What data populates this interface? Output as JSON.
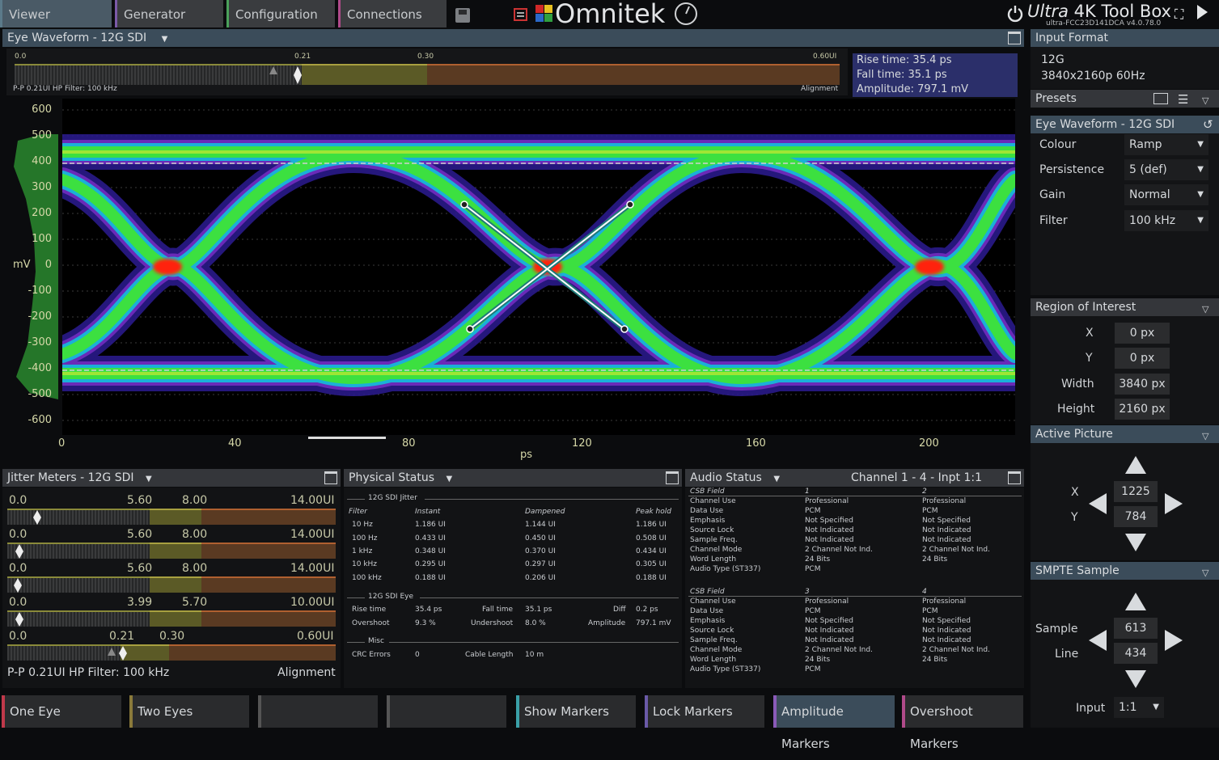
{
  "top_tabs": [
    "Viewer",
    "Generator",
    "Configuration",
    "Connections"
  ],
  "brand": {
    "name": "Omnitek",
    "product_italic": "Ultra",
    "product_rest": "4K Tool Box",
    "version": "ultra-FCC23D141DCA v4.0.78.0"
  },
  "eye_panel": {
    "title": "Eye Waveform - 12G SDI",
    "slider_ticks": [
      "0.0",
      "0.21",
      "0.30",
      "0.60UI"
    ],
    "slider_left_label": "P-P 0.21UI HP Filter: 100 kHz",
    "slider_right_label": "Alignment",
    "info": {
      "rise": "Rise time: 35.4 ps",
      "fall": "Fall time: 35.1 ps",
      "amp": "Amplitude: 797.1 mV"
    },
    "y_ticks": [
      "600",
      "500",
      "400",
      "300",
      "200",
      "100",
      "0",
      "-100",
      "-200",
      "-300",
      "-400",
      "-500",
      "-600"
    ],
    "y_unit": "mV",
    "x_ticks": [
      "0",
      "40",
      "80",
      "120",
      "160",
      "200"
    ],
    "x_unit": "ps"
  },
  "right_panel": {
    "input_format_title": "Input Format",
    "format_line1": "12G",
    "format_line2": "3840x2160p 60Hz",
    "presets_title": "Presets",
    "eye_title": "Eye Waveform - 12G SDI",
    "settings": [
      {
        "label": "Colour",
        "value": "Ramp"
      },
      {
        "label": "Persistence",
        "value": "5 (def)"
      },
      {
        "label": "Gain",
        "value": "Normal"
      },
      {
        "label": "Filter",
        "value": "100 kHz"
      }
    ],
    "roi_title": "Region of Interest",
    "roi": [
      {
        "label": "X",
        "value": "0 px"
      },
      {
        "label": "Y",
        "value": "0 px"
      },
      {
        "label": "Width",
        "value": "3840 px"
      },
      {
        "label": "Height",
        "value": "2160 px"
      }
    ],
    "active_title": "Active Picture",
    "active_x_label": "X",
    "active_x": "1225",
    "active_y_label": "Y",
    "active_y": "784",
    "smpte_title": "SMPTE Sample",
    "sample_label": "Sample",
    "sample": "613",
    "line_label": "Line",
    "line": "434",
    "input_label": "Input",
    "input_value": "1:1"
  },
  "jitter": {
    "title": "Jitter Meters - 12G SDI",
    "meters": [
      {
        "labels": [
          "0.0",
          "5.60",
          "8.00",
          "14.00UI"
        ]
      },
      {
        "labels": [
          "0.0",
          "5.60",
          "8.00",
          "14.00UI"
        ]
      },
      {
        "labels": [
          "0.0",
          "5.60",
          "8.00",
          "14.00UI"
        ]
      },
      {
        "labels": [
          "0.0",
          "3.99",
          "5.70",
          "10.00UI"
        ]
      },
      {
        "labels": [
          "0.0",
          "0.21",
          "0.30",
          "0.60UI"
        ]
      }
    ],
    "footer_left": "P-P 0.21UI HP Filter: 100 kHz",
    "footer_right": "Alignment"
  },
  "physical": {
    "title": "Physical Status",
    "jitter_title": "12G SDI Jitter",
    "headers": [
      "Filter",
      "Instant",
      "Dampened",
      "Peak hold"
    ],
    "rows": [
      [
        "10 Hz",
        "1.186 UI",
        "1.144 UI",
        "1.186 UI"
      ],
      [
        "100 Hz",
        "0.433 UI",
        "0.450 UI",
        "0.508 UI"
      ],
      [
        "1 kHz",
        "0.348 UI",
        "0.370 UI",
        "0.434 UI"
      ],
      [
        "10 kHz",
        "0.295 UI",
        "0.297 UI",
        "0.305 UI"
      ],
      [
        "100 kHz",
        "0.188 UI",
        "0.206 UI",
        "0.188 UI"
      ]
    ],
    "eye_title": "12G SDI Eye",
    "rise_label": "Rise time",
    "rise": "35.4 ps",
    "fall_label": "Fall time",
    "fall": "35.1 ps",
    "diff_label": "Diff",
    "diff": "0.2 ps",
    "over_label": "Overshoot",
    "over": "9.3 %",
    "under_label": "Undershoot",
    "under": "8.0 %",
    "amp_label": "Amplitude",
    "amp": "797.1 mV",
    "misc_title": "Misc",
    "crc_label": "CRC Errors",
    "crc": "0",
    "cable_label": "Cable Length",
    "cable": "10 m"
  },
  "audio": {
    "title": "Audio Status",
    "channel": "Channel 1 - 4 - Inpt 1:1",
    "fields": [
      "CSB Field",
      "Channel Use",
      "Data Use",
      "Emphasis",
      "Source Lock",
      "Sample Freq.",
      "Channel Mode",
      "Word Length",
      "Audio Type (ST337)"
    ],
    "block1": {
      "col_a": [
        "1",
        "Professional",
        "PCM",
        "Not Specified",
        "Not Indicated",
        "Not Indicated",
        "2 Channel Not Ind.",
        "24 Bits",
        "PCM"
      ],
      "col_b": [
        "2",
        "Professional",
        "PCM",
        "Not Specified",
        "Not Indicated",
        "Not Indicated",
        "2 Channel Not Ind.",
        "24 Bits",
        ""
      ]
    },
    "block2": {
      "col_a": [
        "3",
        "Professional",
        "PCM",
        "Not Specified",
        "Not Indicated",
        "Not Indicated",
        "2 Channel Not Ind.",
        "24 Bits",
        "PCM"
      ],
      "col_b": [
        "4",
        "Professional",
        "PCM",
        "Not Specified",
        "Not Indicated",
        "Not Indicated",
        "2 Channel Not Ind.",
        "24 Bits",
        ""
      ]
    }
  },
  "bottom_buttons": [
    {
      "label": "One Eye",
      "color": "#c0394a"
    },
    {
      "label": "Two Eyes",
      "color": "#8a7a3a"
    },
    {
      "label": "",
      "color": "#555555"
    },
    {
      "label": "",
      "color": "#555555"
    },
    {
      "label": "Show Markers",
      "color": "#3aa0a8"
    },
    {
      "label": "Lock Markers",
      "color": "#6a5aa8"
    },
    {
      "label": "Amplitude Markers",
      "color": "#8a5ab8"
    },
    {
      "label": "Overshoot Markers",
      "color": "#b04a8a"
    }
  ]
}
